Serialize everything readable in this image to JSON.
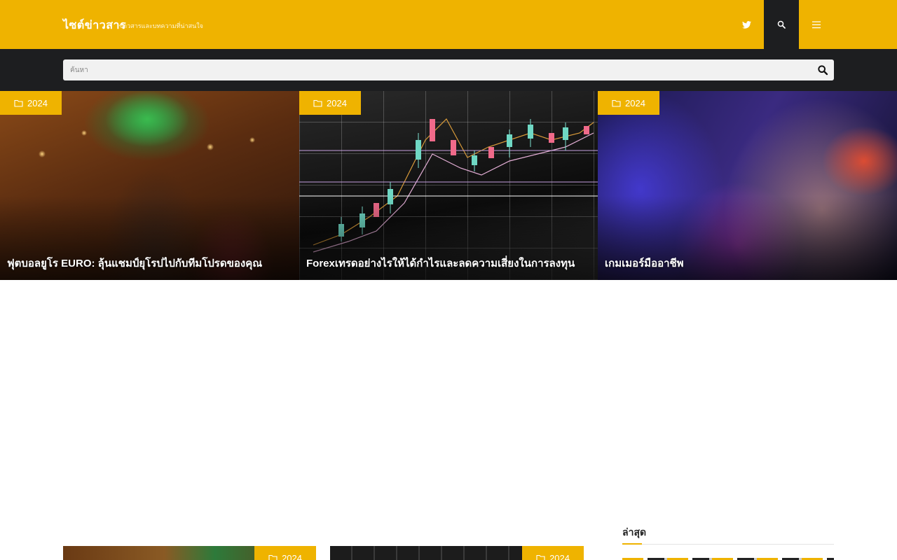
{
  "header": {
    "site_title": "ไซต์ข่าวสาร",
    "site_description": "ข่าวสารและบทความที่น่าสนใจ",
    "twitter_icon": "twitter-icon",
    "search_icon": "search-icon",
    "menu_icon": "menu-icon"
  },
  "search": {
    "placeholder": "ค้นหา",
    "submit_icon": "search-icon"
  },
  "featured": [
    {
      "category": "2024",
      "title": "ฟุตบอลยูโร EURO: ลุ้นแชมป์ยุโรปไปกับทีมโปรดของคุณ",
      "category_icon": "folder-icon"
    },
    {
      "category": "2024",
      "title": "Forexเทรดอย่างไรให้ได้กำไรและลดความเสี่ยงในการลงทุน",
      "category_icon": "folder-icon"
    },
    {
      "category": "2024",
      "title": "เกมเมอร์มืออาชีพ",
      "category_icon": "folder-icon"
    }
  ],
  "posts": [
    {
      "category": "2024",
      "category_icon": "folder-icon"
    },
    {
      "category": "2024",
      "category_icon": "folder-icon"
    }
  ],
  "sidebar": {
    "title": "ล่าสุด"
  },
  "colors": {
    "accent": "#efb300",
    "dark": "#1d1e20"
  }
}
